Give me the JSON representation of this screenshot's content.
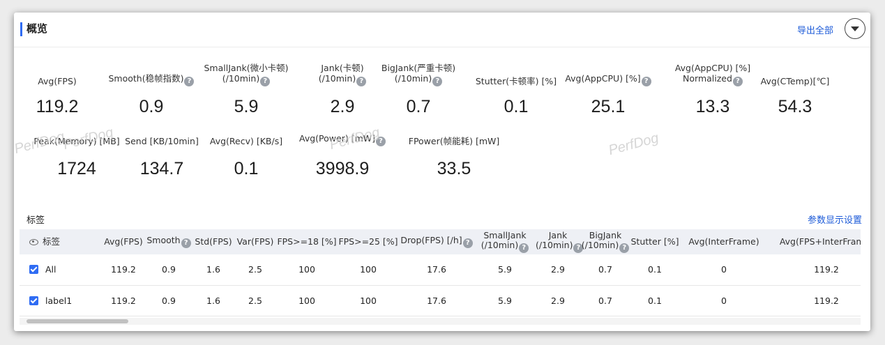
{
  "header": {
    "title": "概览",
    "export_label": "导出全部"
  },
  "metrics_row1": [
    {
      "label_lines": [
        "Avg(FPS)"
      ],
      "help": false,
      "value": "119.2"
    },
    {
      "label_lines": [
        "Smooth(稳帧指数)"
      ],
      "help": true,
      "value": "0.9"
    },
    {
      "label_lines": [
        "SmallJank(微小卡顿)",
        "(/10min)"
      ],
      "help": true,
      "value": "5.9"
    },
    {
      "label_lines": [
        "Jank(卡顿)",
        "(/10min)"
      ],
      "help": true,
      "value": "2.9"
    },
    {
      "label_lines": [
        "BigJank(严重卡顿)",
        "(/10min)"
      ],
      "help": true,
      "value": "0.7"
    },
    {
      "label_lines": [
        "Stutter(卡顿率) [%]"
      ],
      "help": false,
      "value": "0.1"
    },
    {
      "label_lines": [
        "Avg(AppCPU) [%]"
      ],
      "help": true,
      "value": "25.1"
    },
    {
      "label_lines": [
        "Avg(AppCPU) [%]",
        "Normalized"
      ],
      "help": true,
      "value": "13.3"
    },
    {
      "label_lines": [
        "Avg(CTemp)[℃]"
      ],
      "help": false,
      "value": "54.3"
    }
  ],
  "metrics_row2": [
    {
      "label_lines": [
        "Peak(Memory) [MB]"
      ],
      "help": false,
      "value": "1724"
    },
    {
      "label_lines": [
        "Send [KB/10min]"
      ],
      "help": false,
      "value": "134.7"
    },
    {
      "label_lines": [
        "Avg(Recv) [KB/s]"
      ],
      "help": false,
      "value": "0.1"
    },
    {
      "label_lines": [
        "Avg(Power) [mW]"
      ],
      "help": true,
      "value": "3998.9"
    },
    {
      "label_lines": [
        "FPower(帧能耗) [mW]"
      ],
      "help": false,
      "value": "33.5"
    }
  ],
  "watermark": "PerfDog",
  "help_glyph": "?",
  "tags": {
    "title": "标签",
    "param_settings_label": "参数显示设置",
    "columns": [
      {
        "lines": [
          "标签"
        ],
        "help": false
      },
      {
        "lines": [
          "Avg(FPS)"
        ],
        "help": false
      },
      {
        "lines": [
          "Smooth"
        ],
        "help": true
      },
      {
        "lines": [
          "Std(FPS)"
        ],
        "help": false
      },
      {
        "lines": [
          "Var(FPS)"
        ],
        "help": false
      },
      {
        "lines": [
          "FPS>=18 [%]"
        ],
        "help": false
      },
      {
        "lines": [
          "FPS>=25 [%]"
        ],
        "help": false
      },
      {
        "lines": [
          "Drop(FPS) [/h]"
        ],
        "help": true
      },
      {
        "lines": [
          "SmallJank",
          "(/10min)"
        ],
        "help": true
      },
      {
        "lines": [
          "Jank",
          "(/10min)"
        ],
        "help": true
      },
      {
        "lines": [
          "BigJank",
          "(/10min)"
        ],
        "help": true
      },
      {
        "lines": [
          "Stutter [%]"
        ],
        "help": false
      },
      {
        "lines": [
          "Avg(InterFrame)"
        ],
        "help": false
      },
      {
        "lines": [
          "Avg(FPS+InterFrame)"
        ],
        "help": false
      }
    ],
    "rows": [
      {
        "checked": true,
        "cells": [
          "All",
          "119.2",
          "0.9",
          "1.6",
          "2.5",
          "100",
          "100",
          "17.6",
          "5.9",
          "2.9",
          "0.7",
          "0.1",
          "0",
          "119.2"
        ]
      },
      {
        "checked": true,
        "cells": [
          "label1",
          "119.2",
          "0.9",
          "1.6",
          "2.5",
          "100",
          "100",
          "17.6",
          "5.9",
          "2.9",
          "0.7",
          "0.1",
          "0",
          "119.2"
        ]
      }
    ]
  },
  "colors": {
    "accent": "#2f6cf3",
    "link": "#1d5bd8",
    "header_bg": "#eef0f5"
  }
}
